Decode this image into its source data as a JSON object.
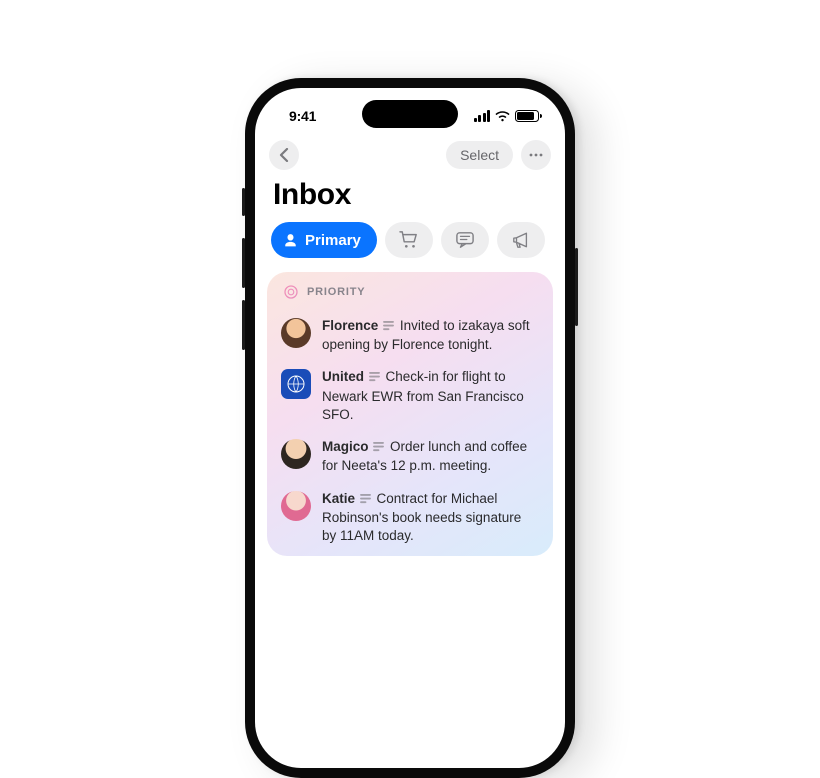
{
  "status": {
    "time": "9:41"
  },
  "nav": {
    "select_label": "Select"
  },
  "title": "Inbox",
  "filters": {
    "primary_label": "Primary"
  },
  "priority": {
    "header": "PRIORITY",
    "messages": [
      {
        "sender": "Florence",
        "summary": "Invited to izakaya soft opening by Florence tonight."
      },
      {
        "sender": "United",
        "summary": "Check-in for flight to Newark EWR from San Francisco SFO."
      },
      {
        "sender": "Magico",
        "summary": "Order lunch and coffee for Neeta's 12 p.m. meeting."
      },
      {
        "sender": "Katie",
        "summary": "Contract for Michael Robinson's book needs signature by 11AM today."
      }
    ]
  },
  "avatars": [
    {
      "bg": "radial-gradient(circle at 50% 40%, #f2c49a 0 40%, #7a4a2e 42% 100%)"
    },
    {
      "bg": "#1a4cb8",
      "type": "square"
    },
    {
      "bg": "radial-gradient(circle at 50% 38%, #f3d0b0 0 42%, #3b2f28 44% 100%)"
    },
    {
      "bg": "radial-gradient(circle at 50% 38%, #f5d4c6 0 40%, #d85a84 42% 100%)"
    }
  ]
}
